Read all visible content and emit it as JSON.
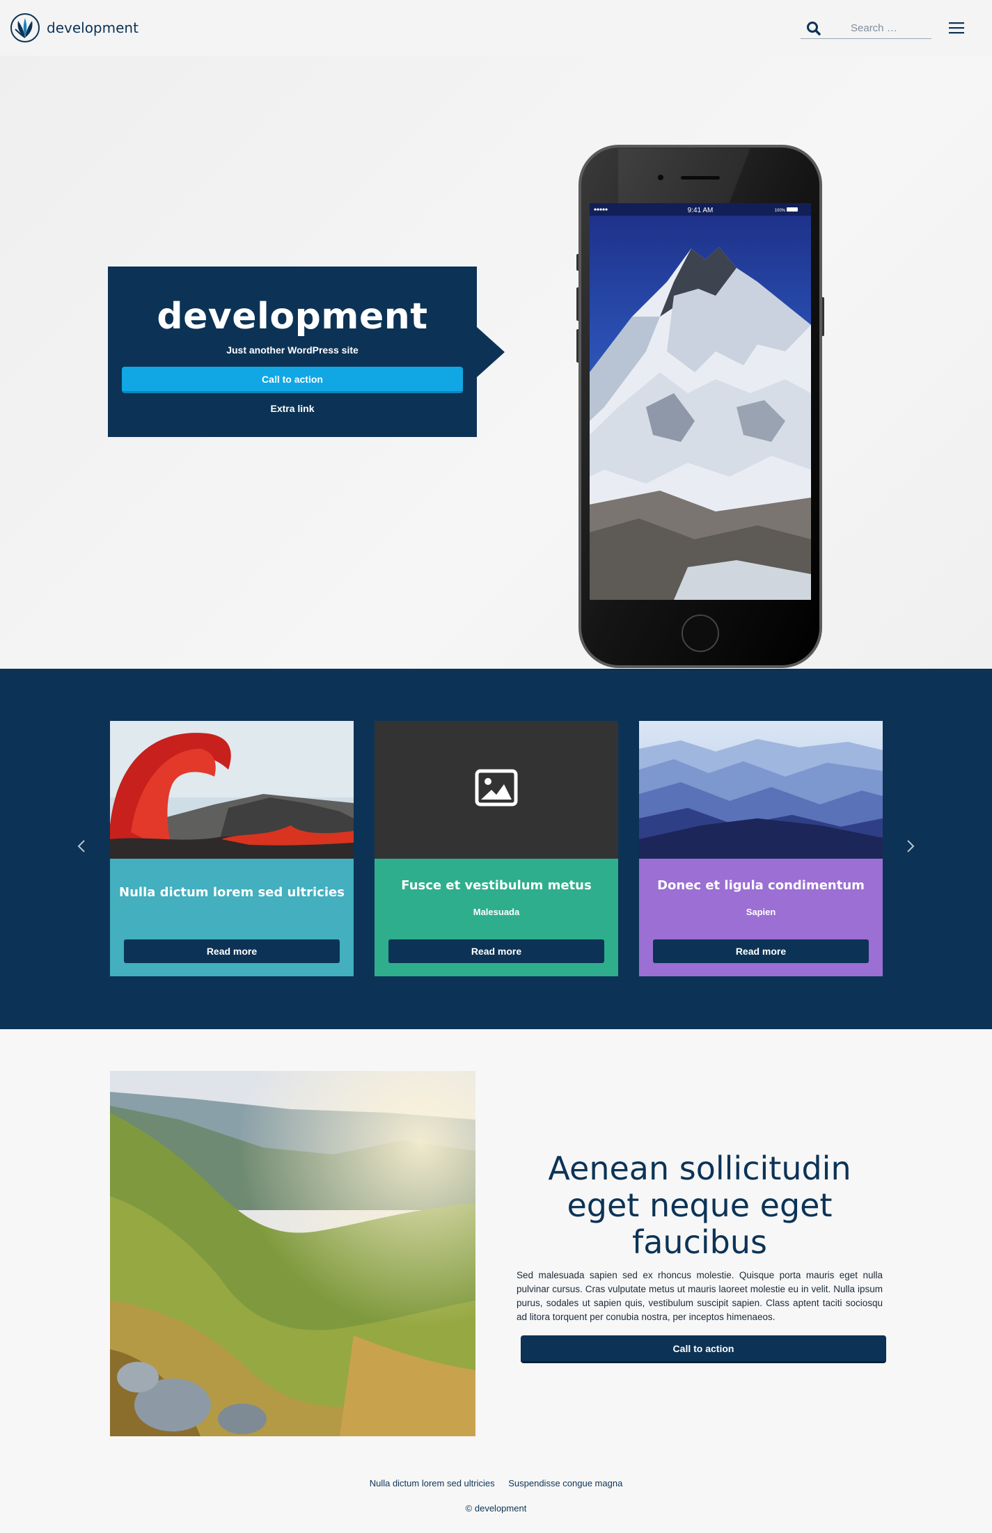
{
  "header": {
    "site_name": "development",
    "logo_icon": "leaf-logo-icon",
    "search": {
      "placeholder": "Search …",
      "value": "",
      "icon": "search-icon"
    },
    "menu_icon": "hamburger-menu-icon"
  },
  "hero": {
    "title": "development",
    "subtitle": "Just another WordPress site",
    "cta_label": "Call to action",
    "extra_link": "Extra link",
    "phone": {
      "status_time": "9:41 AM",
      "battery": "100%"
    }
  },
  "carousel": {
    "prev_icon": "chevron-left-icon",
    "next_icon": "chevron-right-icon",
    "cards": [
      {
        "title": "Nulla dictum lorem sed ultricies",
        "subtitle": "",
        "button": "Read more",
        "color": "#43afbf",
        "image": "volcano-lava-photo"
      },
      {
        "title": "Fusce et vestibulum metus",
        "subtitle": "Malesuada",
        "button": "Read more",
        "color": "#2fae8d",
        "image": "image-placeholder-icon"
      },
      {
        "title": "Donec et ligula condimentum",
        "subtitle": "Sapien",
        "button": "Read more",
        "color": "#9b6fd3",
        "image": "misty-mountains-photo"
      }
    ]
  },
  "feature": {
    "heading": "Aenean sollicitudin eget neque eget faucibus",
    "text": "Sed malesuada sapien sed ex rhoncus molestie. Quisque porta mauris eget nulla pulvinar cursus. Cras vulputate metus ut mauris laoreet molestie eu in velit. Nulla ipsum purus, sodales ut sapien quis, vestibulum suscipit sapien. Class aptent taciti sociosqu ad litora torquent per conubia nostra, per inceptos himenaeos.",
    "cta_label": "Call to action"
  },
  "footer": {
    "links": [
      "Nulla dictum lorem sed ultricies",
      "Suspendisse congue magna"
    ],
    "copyright": "© development"
  },
  "colors": {
    "navy": "#0c3356",
    "accent_blue": "#10a7e4",
    "teal": "#43afbf",
    "green": "#2fae8d",
    "purple": "#9b6fd3"
  }
}
